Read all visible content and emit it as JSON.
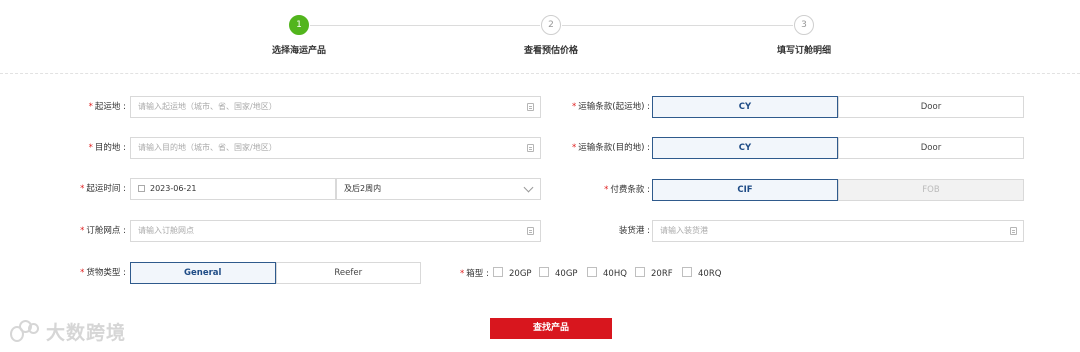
{
  "steps": [
    {
      "num": "1",
      "label": "选择海运产品",
      "state": "active"
    },
    {
      "num": "2",
      "label": "查看预估价格",
      "state": "inactive"
    },
    {
      "num": "3",
      "label": "填写订舱明细",
      "state": "inactive"
    }
  ],
  "form": {
    "origin": {
      "label": "起运地 :",
      "placeholder": "请输入起运地（城市、省、国家/地区）"
    },
    "destination": {
      "label": "目的地 :",
      "placeholder": "请输入目的地（城市、省、国家/地区）"
    },
    "depart_time": {
      "label": "起运时间 :",
      "date": "2023-06-21",
      "range": "及后2周内"
    },
    "booking_point": {
      "label": "订舱网点 :",
      "placeholder": "请输入订舱网点"
    },
    "cargo_type": {
      "label": "货物类型 :",
      "options": [
        "General",
        "Reefer"
      ],
      "selected": "General"
    },
    "terms_origin": {
      "label": "运输条款(起运地) :",
      "options": [
        "CY",
        "Door"
      ],
      "selected": "CY"
    },
    "terms_dest": {
      "label": "运输条款(目的地) :",
      "options": [
        "CY",
        "Door"
      ],
      "selected": "CY"
    },
    "payment": {
      "label": "付费条款 :",
      "options": [
        "CIF",
        "FOB"
      ],
      "selected": "CIF",
      "disabled": "FOB"
    },
    "loading_port": {
      "label": "装货港 :",
      "placeholder": "请输入装货港"
    },
    "box_type": {
      "label": "箱型 :",
      "options": [
        "20GP",
        "40GP",
        "40HQ",
        "20RF",
        "40RQ"
      ]
    }
  },
  "submit_label": "查找产品",
  "watermark": "大数跨境",
  "colors": {
    "accent": "#d8161e",
    "step_active": "#52b51d",
    "selected_border": "#2f5a8c",
    "required": "#e02020"
  }
}
